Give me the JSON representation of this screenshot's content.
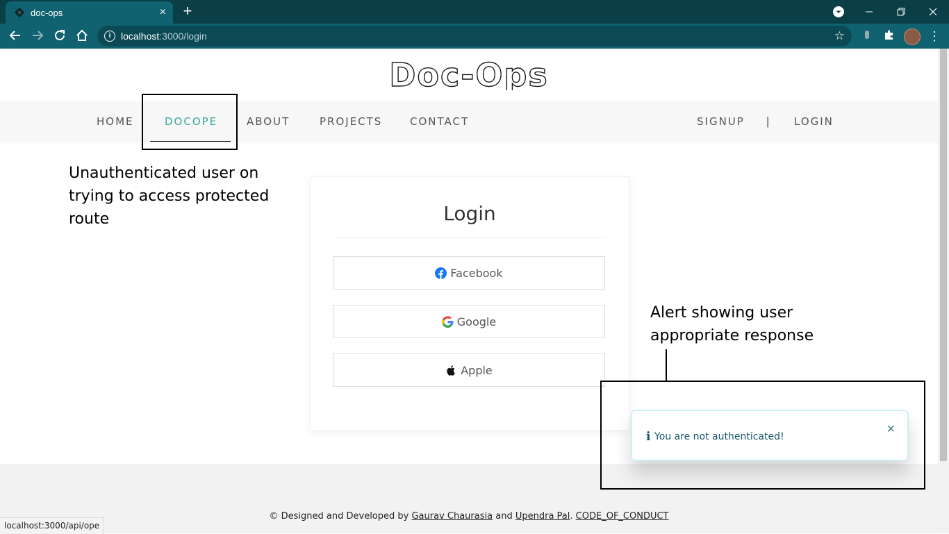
{
  "browser": {
    "tab_title": "doc-ops",
    "tab_close_icon": "×",
    "new_tab_icon": "+",
    "url_host": "localhost",
    "url_path": ":3000/login",
    "status_url": "localhost:3000/api/ope"
  },
  "site": {
    "logo_text": "Doc-Ops",
    "nav": {
      "home": "HOME",
      "docope": "DOCOPE",
      "about": "ABOUT",
      "projects": "PROJECTS",
      "contact": "CONTACT",
      "signup": "SIGNUP",
      "separator": "|",
      "login": "LOGIN"
    }
  },
  "login_card": {
    "title": "Login",
    "buttons": {
      "facebook": "Facebook",
      "google": "Google",
      "apple": "Apple"
    }
  },
  "alert": {
    "icon": "i",
    "message": "You are not authenticated!",
    "close": "×"
  },
  "annotations": {
    "left_line1": "Unauthenticated user on",
    "left_line2": "trying to access protected",
    "left_line3": "route",
    "right_line1": "Alert showing user",
    "right_line2": "appropriate response"
  },
  "footer": {
    "prefix": "© Designed and Developed by",
    "author1": "Gaurav Chaurasia",
    "and": "and",
    "author2": "Upendra Pal",
    "dot": ".",
    "conduct": "CODE_OF_CONDUCT"
  },
  "colors": {
    "tab_bar": "#0b3f47",
    "toolbar": "#116270",
    "accent": "#3aa89c",
    "alert_text": "#17566b"
  }
}
